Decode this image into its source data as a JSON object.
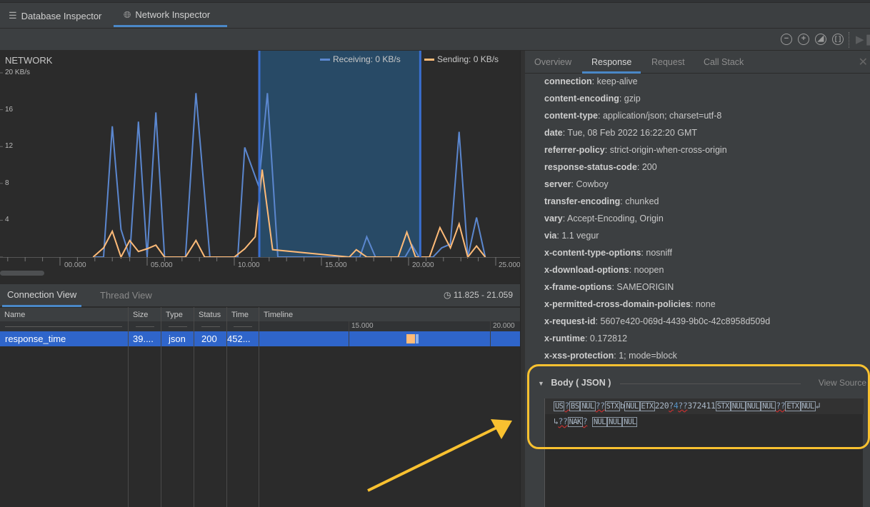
{
  "top_tabs": [
    {
      "label": "Database Inspector",
      "icon": "database-icon",
      "active": false
    },
    {
      "label": "Network Inspector",
      "icon": "globe-icon",
      "active": true
    }
  ],
  "toolbar": {
    "zoom_out": "zoom-out",
    "zoom_in": "zoom-in",
    "reset_zoom": "reset-zoom",
    "zoom_to_selection": "zoom-to-selection",
    "go_live": "go-live"
  },
  "chart_data": {
    "type": "line",
    "title": "NETWORK",
    "ylabel": "KB/s",
    "ylim": [
      0,
      20
    ],
    "xlim": [
      -3.4,
      25.0
    ],
    "y_ticks": [
      "20 KB/s",
      "16",
      "12",
      "8",
      "4"
    ],
    "x_ticks": [
      "00.000",
      "05.000",
      "10.000",
      "15.000",
      "20.000",
      "25.000"
    ],
    "legend": [
      {
        "name": "Receiving",
        "label": "Receiving: 0 KB/s",
        "color": "#5b87cf"
      },
      {
        "name": "Sending",
        "label": "Sending: 0 KB/s",
        "color": "#ffbb78"
      }
    ],
    "legend_position": "top-right",
    "selection": {
      "start": 11.825,
      "end": 21.059
    },
    "series": [
      {
        "name": "Receiving",
        "color": "#5b87cf",
        "x": [
          2.0,
          2.5,
          3.0,
          3.5,
          4.0,
          4.5,
          5.0,
          5.5,
          6.0,
          6.5,
          7.2,
          7.8,
          8.6,
          10.2,
          10.6,
          11.4,
          11.9,
          12.5,
          12.9,
          17.2,
          17.6,
          18.1,
          19.8,
          20.2,
          20.6,
          21.4,
          21.9,
          22.4,
          22.9,
          23.4,
          23.9,
          24.4
        ],
        "values": [
          0,
          0,
          14.2,
          3.0,
          0,
          14.7,
          0,
          15.7,
          0,
          0,
          0,
          17.8,
          0,
          0,
          11.9,
          7.7,
          17.8,
          0,
          0,
          0,
          2.2,
          0,
          0,
          1.3,
          0,
          0,
          1.0,
          1.4,
          13.6,
          0,
          4.3,
          0
        ]
      },
      {
        "name": "Sending",
        "color": "#ffbb78",
        "x": [
          1.9,
          2.5,
          3.0,
          3.5,
          4.0,
          4.5,
          5.0,
          5.5,
          6.0,
          7.2,
          7.8,
          8.3,
          10.0,
          10.6,
          11.2,
          11.6,
          12.2,
          16.6,
          17.0,
          17.6,
          19.4,
          19.9,
          20.4,
          21.2,
          21.8,
          22.4,
          22.9,
          23.4,
          23.9,
          24.4
        ],
        "values": [
          0,
          1.0,
          2.8,
          0,
          1.8,
          0.6,
          0.9,
          1.3,
          0,
          0,
          1.8,
          0,
          0,
          0.9,
          2.2,
          9.5,
          0.8,
          0,
          0.8,
          0,
          0,
          2.7,
          0,
          0,
          3.2,
          1.0,
          3.6,
          0,
          1.2,
          0
        ]
      }
    ]
  },
  "connection": {
    "tabs": [
      {
        "label": "Connection View",
        "active": true
      },
      {
        "label": "Thread View",
        "active": false
      }
    ],
    "range": "11.825 - 21.059",
    "columns": [
      "Name",
      "Size",
      "Type",
      "Status",
      "Time",
      "Timeline"
    ],
    "timeline_ticks": [
      "15.000",
      "20.000"
    ],
    "rows": [
      {
        "name": "response_time",
        "size": "39....",
        "type": "json",
        "status": "200",
        "time": "452..."
      }
    ]
  },
  "detail": {
    "tabs": [
      {
        "label": "Overview",
        "active": false
      },
      {
        "label": "Response",
        "active": true
      },
      {
        "label": "Request",
        "active": false
      },
      {
        "label": "Call Stack",
        "active": false
      }
    ],
    "headers": [
      {
        "key": "connection",
        "value": "keep-alive"
      },
      {
        "key": "content-encoding",
        "value": "gzip"
      },
      {
        "key": "content-type",
        "value": "application/json; charset=utf-8"
      },
      {
        "key": "date",
        "value": "Tue, 08 Feb 2022 16:22:20 GMT"
      },
      {
        "key": "referrer-policy",
        "value": "strict-origin-when-cross-origin"
      },
      {
        "key": "response-status-code",
        "value": "200"
      },
      {
        "key": "server",
        "value": "Cowboy"
      },
      {
        "key": "transfer-encoding",
        "value": "chunked"
      },
      {
        "key": "vary",
        "value": "Accept-Encoding, Origin"
      },
      {
        "key": "via",
        "value": "1.1 vegur"
      },
      {
        "key": "x-content-type-options",
        "value": "nosniff"
      },
      {
        "key": "x-download-options",
        "value": "noopen"
      },
      {
        "key": "x-frame-options",
        "value": "SAMEORIGIN"
      },
      {
        "key": "x-permitted-cross-domain-policies",
        "value": "none"
      },
      {
        "key": "x-request-id",
        "value": "5607e420-069d-4439-9b0c-42c8958d509d"
      },
      {
        "key": "x-runtime",
        "value": "0.172812"
      },
      {
        "key": "x-xss-protection",
        "value": "1; mode=block"
      }
    ],
    "body": {
      "title": "Body ( JSON )",
      "view_source": "View Source",
      "line1": [
        {
          "t": "US",
          "k": "cc"
        },
        {
          "t": "?",
          "k": "bad"
        },
        {
          "t": "BS",
          "k": "cc"
        },
        {
          "t": "NUL",
          "k": "cc"
        },
        {
          "t": "??",
          "k": "bad"
        },
        {
          "t": "STX",
          "k": "cc"
        },
        {
          "t": "b",
          "k": "plain"
        },
        {
          "t": "NUL",
          "k": "cc"
        },
        {
          "t": "ETX",
          "k": "cc"
        },
        {
          "t": "220",
          "k": "plain"
        },
        {
          "t": "?",
          "k": "bad"
        },
        {
          "t": "4",
          "k": "blue"
        },
        {
          "t": "??",
          "k": "bad"
        },
        {
          "t": "372411",
          "k": "plain"
        },
        {
          "t": "STX",
          "k": "cc"
        },
        {
          "t": "NUL",
          "k": "cc"
        },
        {
          "t": "NUL",
          "k": "cc"
        },
        {
          "t": "NUL",
          "k": "cc"
        },
        {
          "t": "??",
          "k": "bad"
        },
        {
          "t": "ETX",
          "k": "cc"
        },
        {
          "t": "NUL",
          "k": "cc"
        },
        {
          "t": "↲",
          "k": "plain"
        }
      ],
      "line2": [
        {
          "t": "↳",
          "k": "plain"
        },
        {
          "t": "??",
          "k": "bad"
        },
        {
          "t": "NAK",
          "k": "cc"
        },
        {
          "t": "?",
          "k": "bad"
        },
        {
          "t": " ",
          "k": "plain"
        },
        {
          "t": "NUL",
          "k": "cc"
        },
        {
          "t": "NUL",
          "k": "cc"
        },
        {
          "t": "NUL",
          "k": "cc"
        }
      ]
    }
  },
  "annotation": {
    "color": "#f9c130"
  }
}
